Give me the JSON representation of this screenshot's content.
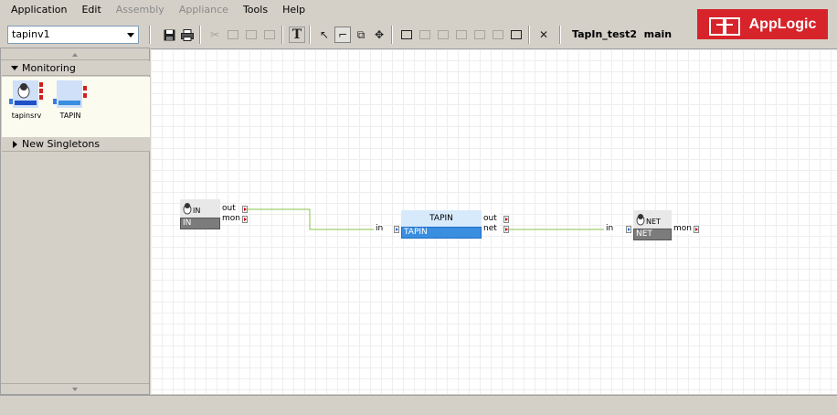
{
  "menu": {
    "items": [
      {
        "label": "Application",
        "enabled": true
      },
      {
        "label": "Edit",
        "enabled": true
      },
      {
        "label": "Assembly",
        "enabled": false
      },
      {
        "label": "Appliance",
        "enabled": false
      },
      {
        "label": "Tools",
        "enabled": true
      },
      {
        "label": "Help",
        "enabled": true
      }
    ]
  },
  "brand": {
    "name": "AppLogic",
    "color": "#d7232a"
  },
  "toolbar": {
    "app_select_value": "tapinv1",
    "title": "TapIn_test2  main",
    "text_tool": "T"
  },
  "palette": {
    "categories": [
      {
        "label": "Monitoring",
        "expanded": true
      },
      {
        "label": "New Singletons",
        "expanded": false
      }
    ],
    "items": [
      {
        "label": "tapinsrv",
        "icon": "linux-appliance-icon"
      },
      {
        "label": "TAPIN",
        "icon": "tap-appliance-icon"
      }
    ]
  },
  "canvas": {
    "components": [
      {
        "id": "in",
        "head": "IN",
        "foot": "IN",
        "outputs": [
          "out",
          "mon"
        ]
      },
      {
        "id": "tapin",
        "head": "TAPIN",
        "foot": "TAPIN",
        "inputs": [
          "in"
        ],
        "outputs": [
          "out",
          "net"
        ]
      },
      {
        "id": "net",
        "head": "NET",
        "foot": "NET",
        "inputs": [
          "in"
        ],
        "outputs": [
          "mon"
        ]
      }
    ],
    "wire_color": "#8bc34a"
  }
}
